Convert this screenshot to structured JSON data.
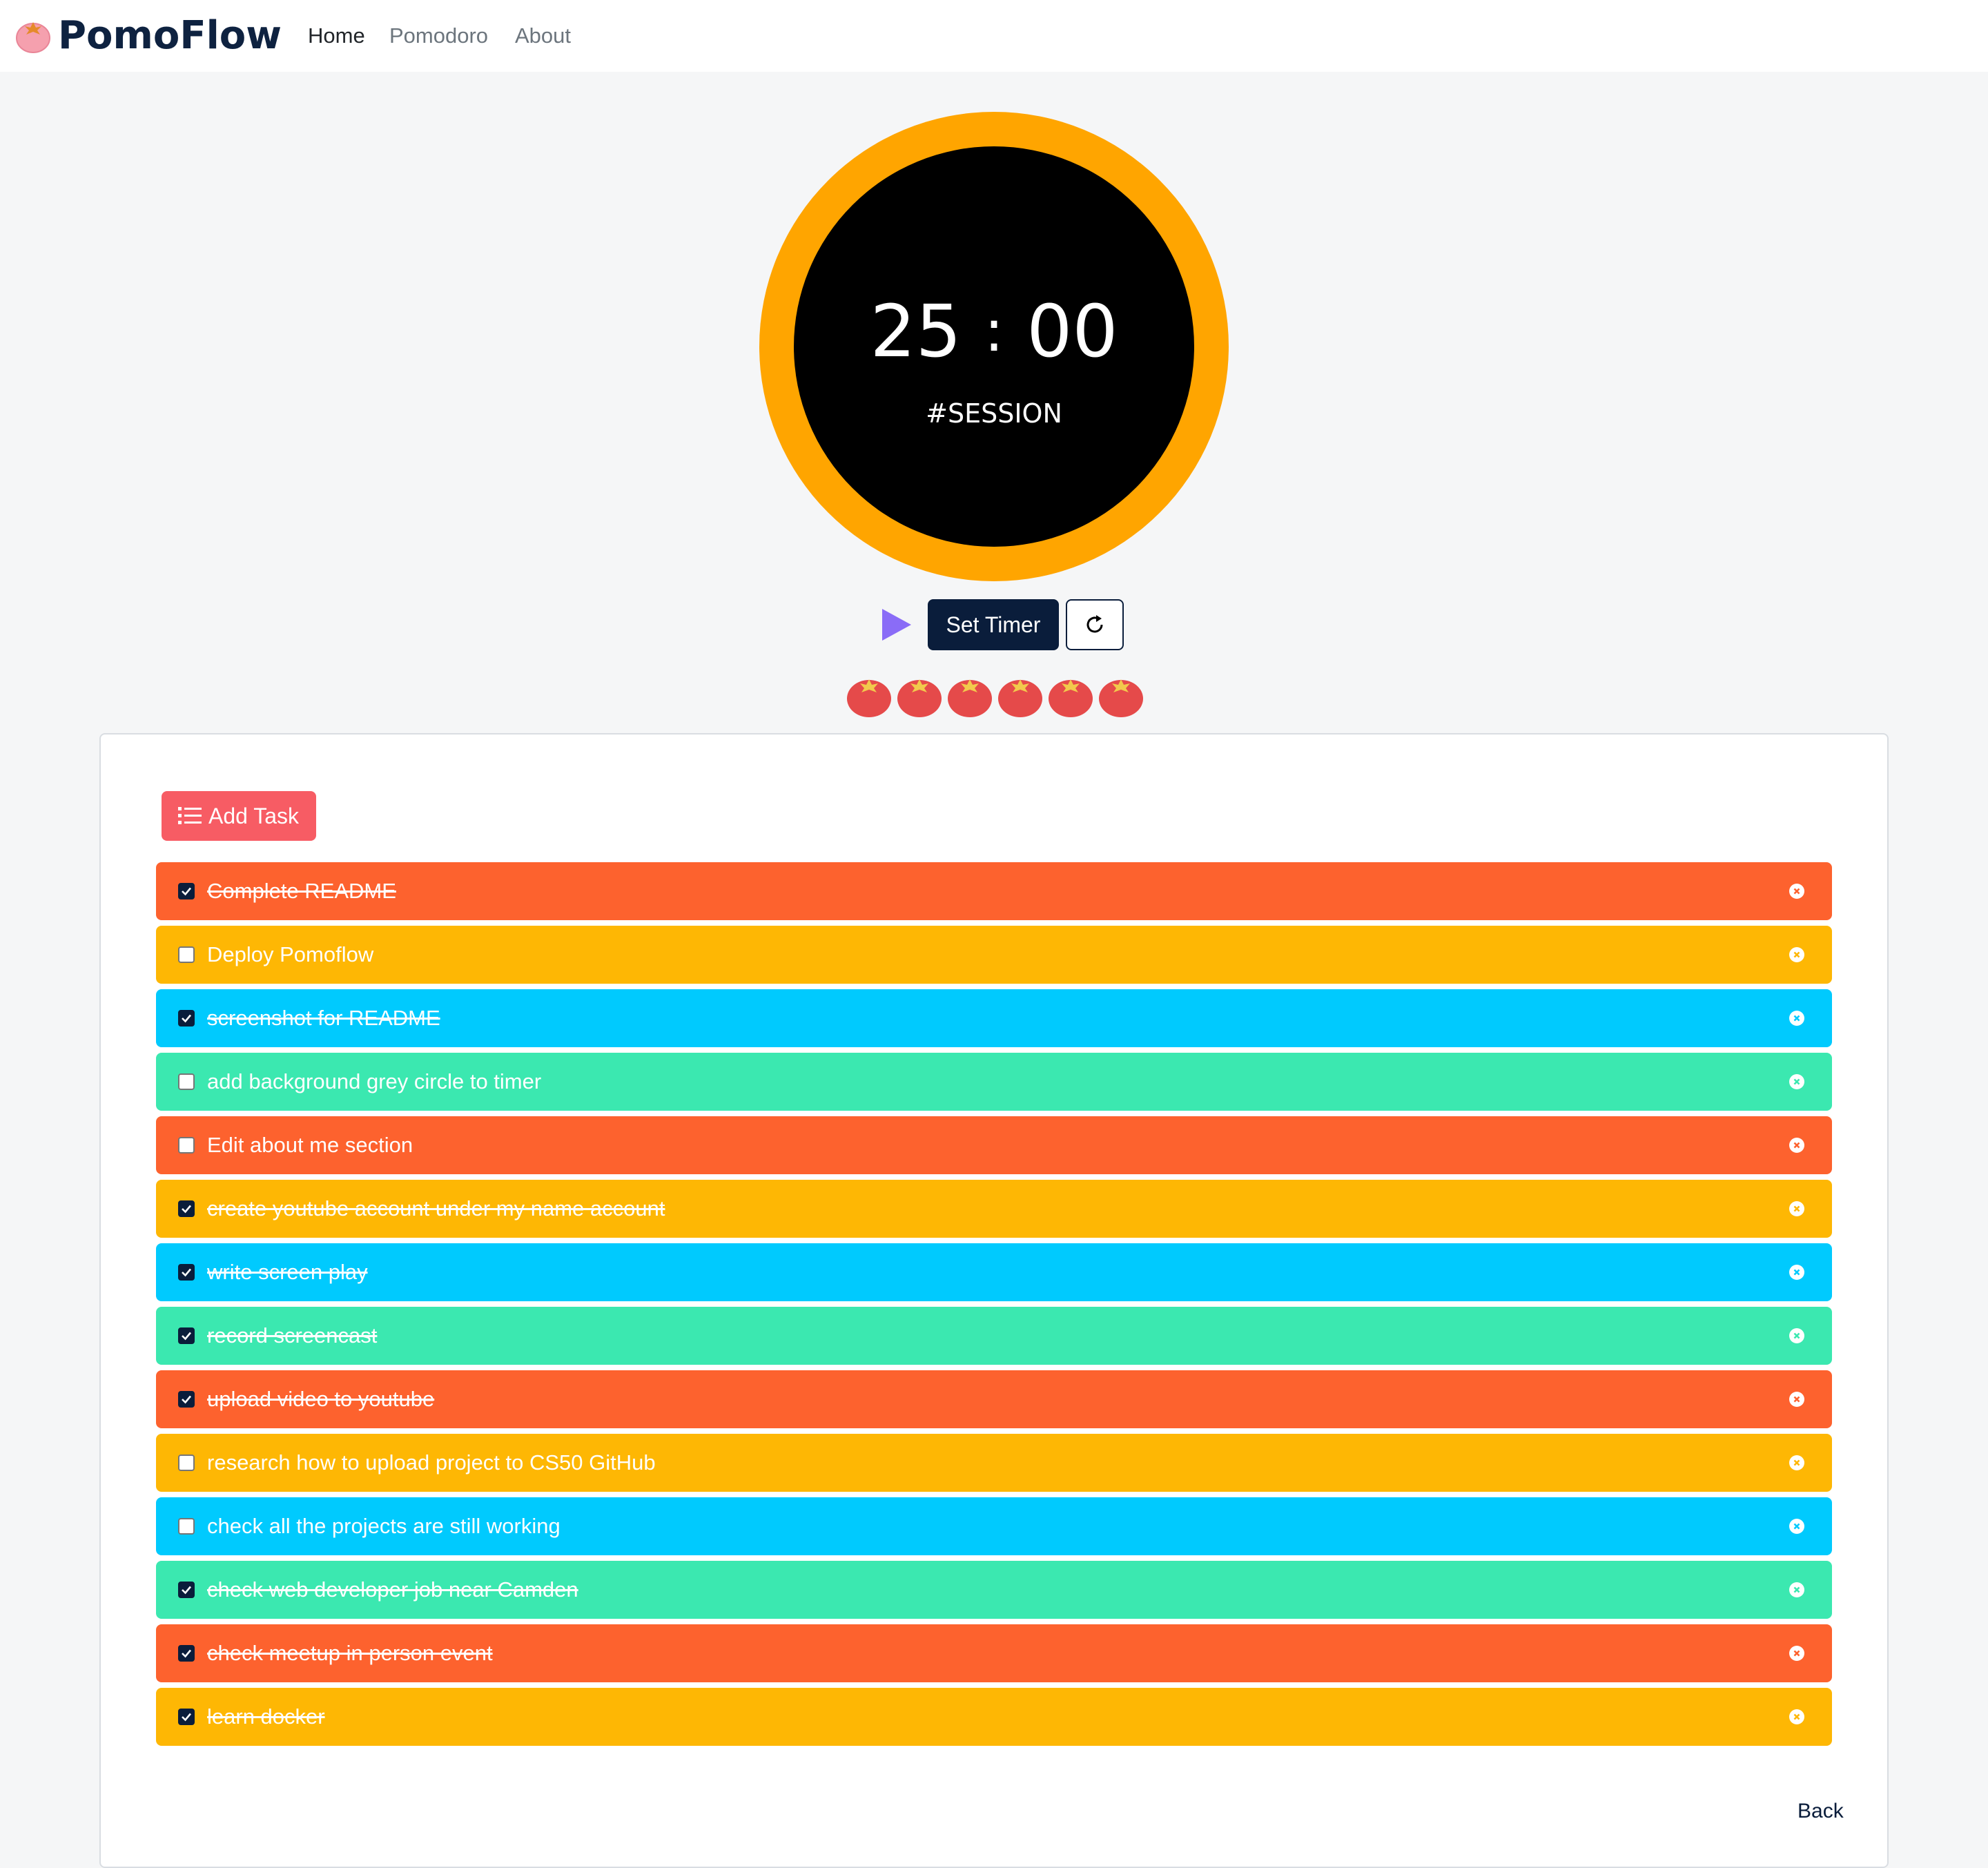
{
  "brand": {
    "name": "PomoFlow"
  },
  "nav": [
    {
      "label": "Home",
      "active": true
    },
    {
      "label": "Pomodoro",
      "active": false
    },
    {
      "label": "About",
      "active": false
    }
  ],
  "timer": {
    "minutes": "25",
    "separator": ":",
    "seconds": "00",
    "label": "#SESSION",
    "ring_color": "#ffa500"
  },
  "controls": {
    "play_icon": "play-icon",
    "set_timer_label": "Set Timer",
    "reset_icon": "refresh-icon"
  },
  "completed_pomodoros": 6,
  "add_task_label": "Add Task",
  "tasks": [
    {
      "text": "Complete README",
      "done": true,
      "color": "#fd622e"
    },
    {
      "text": "Deploy Pomoflow",
      "done": false,
      "color": "#feb704"
    },
    {
      "text": "screenshot for README",
      "done": true,
      "color": "#00cafe"
    },
    {
      "text": "add background grey circle to timer",
      "done": false,
      "color": "#3be8b0"
    },
    {
      "text": "Edit about me section",
      "done": false,
      "color": "#fd622e"
    },
    {
      "text": "create youtube account under my name account",
      "done": true,
      "color": "#feb704"
    },
    {
      "text": "write screen play",
      "done": true,
      "color": "#00cafe"
    },
    {
      "text": "record screencast",
      "done": true,
      "color": "#3be8b0"
    },
    {
      "text": "upload video to youtube",
      "done": true,
      "color": "#fd622e"
    },
    {
      "text": "research how to upload project to CS50 GitHub",
      "done": false,
      "color": "#feb704"
    },
    {
      "text": "check all the projects are still working",
      "done": false,
      "color": "#00cafe"
    },
    {
      "text": "check web developer job near Camden",
      "done": true,
      "color": "#3be8b0"
    },
    {
      "text": "check meetup in person event",
      "done": true,
      "color": "#fd622e"
    },
    {
      "text": "learn docker",
      "done": true,
      "color": "#feb704"
    }
  ],
  "back_label": "Back",
  "colors": {
    "navy": "#0a1d3b",
    "add_task": "#f75c64",
    "play": "#8a6cf7"
  }
}
